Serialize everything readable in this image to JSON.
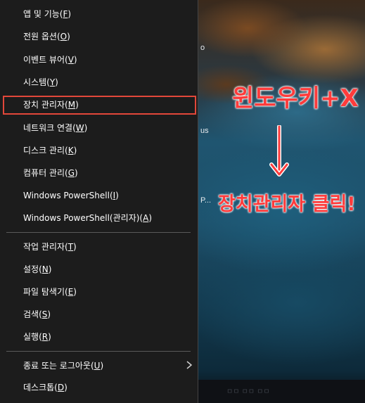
{
  "menu": {
    "items": [
      {
        "label": "앱 및 기능",
        "key": "F"
      },
      {
        "label": "전원 옵션",
        "key": "O"
      },
      {
        "label": "이벤트 뷰어",
        "key": "V"
      },
      {
        "label": "시스템",
        "key": "Y"
      },
      {
        "label": "장치 관리자",
        "key": "M"
      },
      {
        "label": "네트워크 연결",
        "key": "W"
      },
      {
        "label": "디스크 관리",
        "key": "K"
      },
      {
        "label": "컴퓨터 관리",
        "key": "G"
      },
      {
        "label": "Windows PowerShell",
        "key": "I"
      },
      {
        "label": "Windows PowerShell(관리자)",
        "key": "A"
      },
      {
        "label": "작업 관리자",
        "key": "T"
      },
      {
        "label": "설정",
        "key": "N"
      },
      {
        "label": "파일 탐색기",
        "key": "E"
      },
      {
        "label": "검색",
        "key": "S"
      },
      {
        "label": "실행",
        "key": "R"
      },
      {
        "label": "종료 또는 로그아웃",
        "key": "U"
      },
      {
        "label": "데스크톱",
        "key": "D"
      }
    ],
    "highlighted_item": "장치 관리자"
  },
  "desktop": {
    "fragments": [
      "o",
      "us",
      "P..."
    ],
    "taskbar_text": "ㅁㅁ ㅁㅁ ㅁㅁ"
  },
  "annotation": {
    "line1": "윈도우키+X",
    "line2": "장치관리자 클릭!",
    "color": "#ff3b3b"
  },
  "colors": {
    "menu_bg": "#1c1c1c",
    "menu_text": "#ffffff",
    "highlight_border": "#e2473a",
    "separator": "#5a5a5a"
  }
}
